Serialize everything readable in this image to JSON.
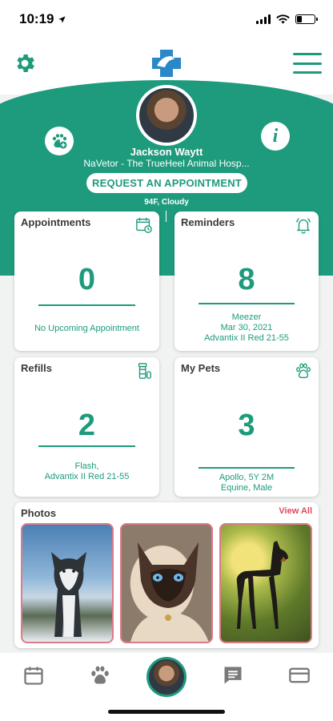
{
  "status": {
    "time": "10:19"
  },
  "profile": {
    "name": "Jackson Waytt",
    "hospital": "NaVetor - The TrueHeel Animal Hosp...",
    "request_button": "REQUEST AN APPOINTMENT",
    "weather": "94F, Cloudy"
  },
  "cards": {
    "appointments": {
      "title": "Appointments",
      "count": "0",
      "sub": "No Upcoming Appointment"
    },
    "reminders": {
      "title": "Reminders",
      "count": "8",
      "line1": "Meezer",
      "line2": "Mar 30, 2021",
      "line3": "Advantix II Red 21-55"
    },
    "refills": {
      "title": "Refills",
      "count": "2",
      "line1": "Flash,",
      "line2": "Advantix II Red 21-55"
    },
    "pets": {
      "title": "My Pets",
      "count": "3",
      "line1": "Apollo, 5Y 2M",
      "line2": "Equine, Male"
    }
  },
  "photos": {
    "title": "Photos",
    "view_all": "View All"
  },
  "colors": {
    "primary": "#1d9b7c",
    "accent": "#e0495f",
    "nav_icon": "#7a7a7a"
  },
  "icons": {
    "settings": "gear-icon",
    "menu": "hamburger-menu-icon",
    "pet": "paw-plus-icon",
    "info": "info-icon",
    "appointments": "calendar-clock-icon",
    "reminders": "ringing-bell-icon",
    "refills": "pill-bottle-icon",
    "pets": "paw-icon",
    "nav": [
      "calendar-icon",
      "paw-icon",
      "profile-avatar",
      "chat-icon",
      "credit-card-icon"
    ]
  }
}
